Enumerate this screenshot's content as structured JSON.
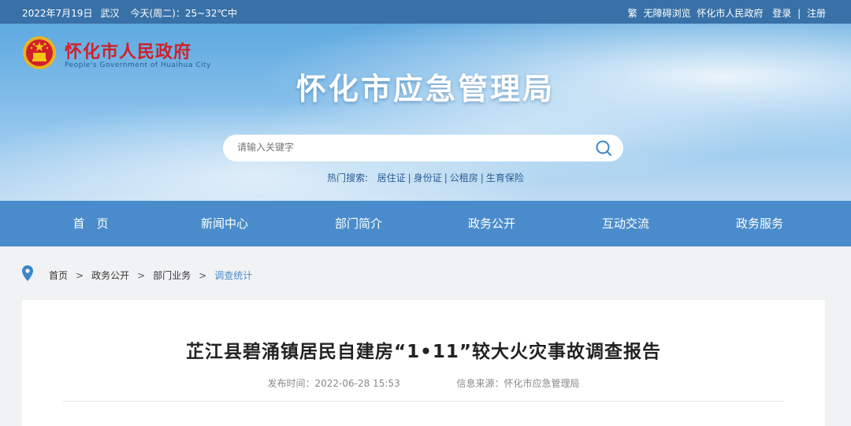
{
  "topbar": {
    "date": "2022年7月19日",
    "city": "武汉",
    "weather": "今天(周二)：25~32℃中",
    "traditional": "繁",
    "accessible": "无障碍浏览",
    "gov_link": "怀化市人民政府",
    "login": "登录",
    "divider": "|",
    "register": "注册"
  },
  "header": {
    "gov_name": "怀化市人民政府",
    "gov_en": "People's Government of Huaihua City",
    "site_title": "怀化市应急管理局",
    "search_placeholder": "请输入关键字",
    "hot_label": "热门搜索:",
    "hot_items": [
      "居住证",
      "身份证",
      "公租房",
      "生育保险"
    ]
  },
  "nav": {
    "items": [
      "首　页",
      "新闻中心",
      "部门简介",
      "政务公开",
      "互动交流",
      "政务服务"
    ]
  },
  "breadcrumb": {
    "items": [
      "首页",
      "政务公开",
      "部门业务",
      "调查统计"
    ],
    "separator": ">"
  },
  "article": {
    "title": "芷江县碧涌镇居民自建房“1•11”较大火灾事故调查报告",
    "publish_time": "发布时间：2022-06-28 15:53",
    "source": "信息来源：怀化市应急管理局"
  },
  "colors": {
    "topbar": "#2866a0",
    "nav": "#4a8ccb",
    "gov_red": "#d0212a"
  }
}
